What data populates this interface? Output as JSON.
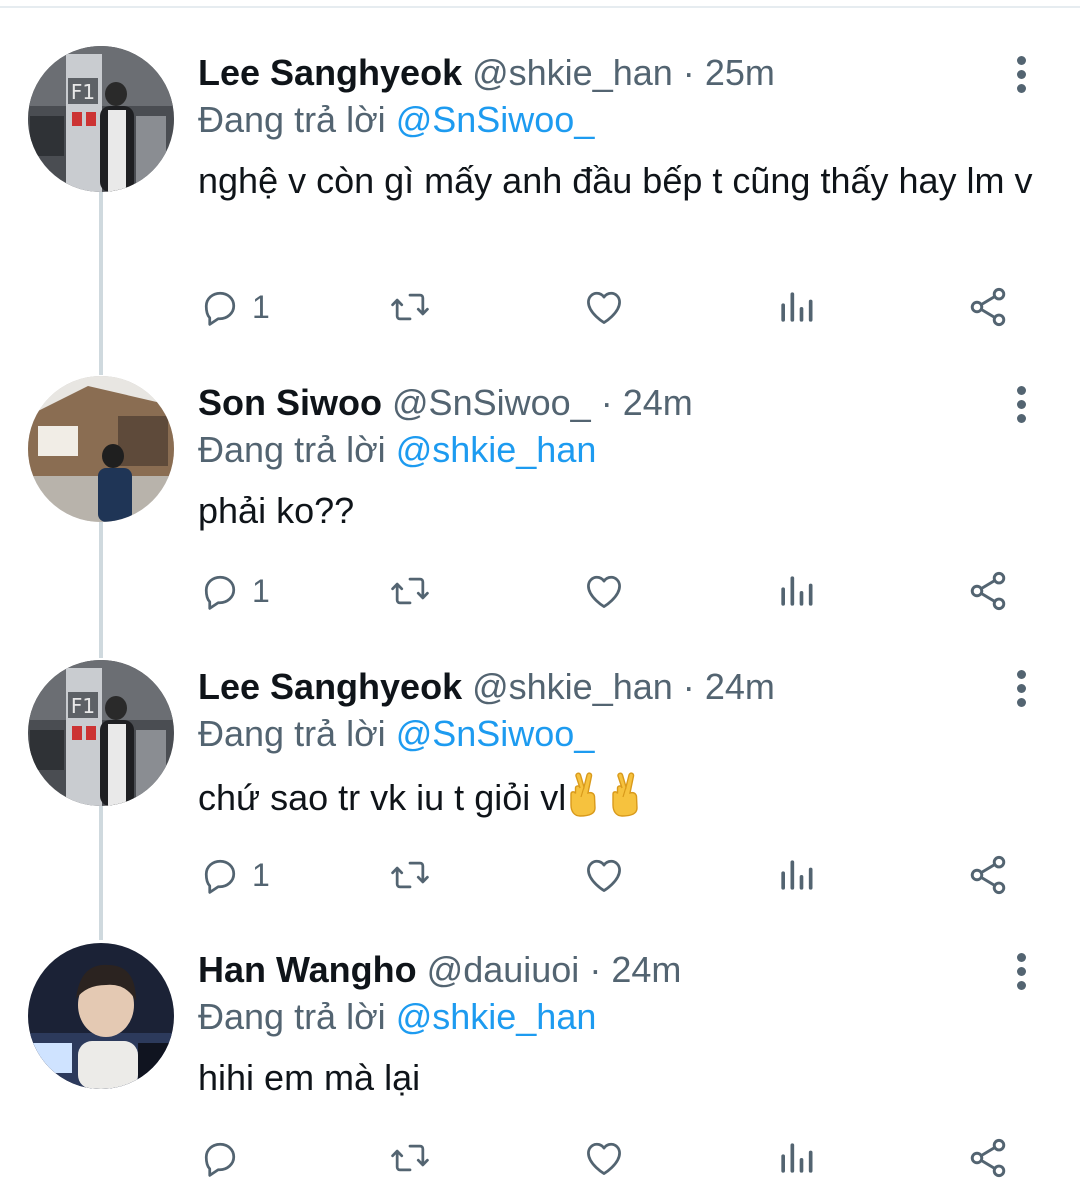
{
  "tweets": [
    {
      "name": "Lee Sanghyeok",
      "handle": "@shkie_han",
      "time": "25m",
      "reply_prefix": "Đang trả lời",
      "reply_to": "@SnSiwoo_",
      "text": "nghệ v còn gì mấy anh đầu bếp t cũng thấy hay lm v",
      "reply_count": "1",
      "avatar_icon": "avatar-parking-garage-photo"
    },
    {
      "name": "Son Siwoo",
      "handle": "@SnSiwoo_",
      "time": "24m",
      "reply_prefix": "Đang trả lời",
      "reply_to": "@shkie_han",
      "text": "phải ko??",
      "reply_count": "1",
      "avatar_icon": "avatar-street-photo"
    },
    {
      "name": "Lee Sanghyeok",
      "handle": "@shkie_han",
      "time": "24m",
      "reply_prefix": "Đang trả lời",
      "reply_to": "@SnSiwoo_",
      "text": "chứ sao tr vk iu t giỏi vl",
      "reply_count": "1",
      "avatar_icon": "avatar-parking-garage-photo",
      "emoji": [
        "crossed-fingers-emoji",
        "crossed-fingers-emoji"
      ]
    },
    {
      "name": "Han Wangho",
      "handle": "@dauiuoi",
      "time": "24m",
      "reply_prefix": "Đang trả lời",
      "reply_to": "@shkie_han",
      "text": "hihi em mà lại",
      "reply_count": "",
      "avatar_icon": "avatar-portrait-photo"
    }
  ],
  "separator": "·",
  "colors": {
    "text": "#0f1419",
    "secondary": "#536471",
    "mention": "#1d9bf0",
    "thread_line": "#cfd9de"
  },
  "icons": [
    "reply-icon",
    "retweet-icon",
    "like-icon",
    "analytics-icon",
    "share-icon",
    "more-icon"
  ]
}
